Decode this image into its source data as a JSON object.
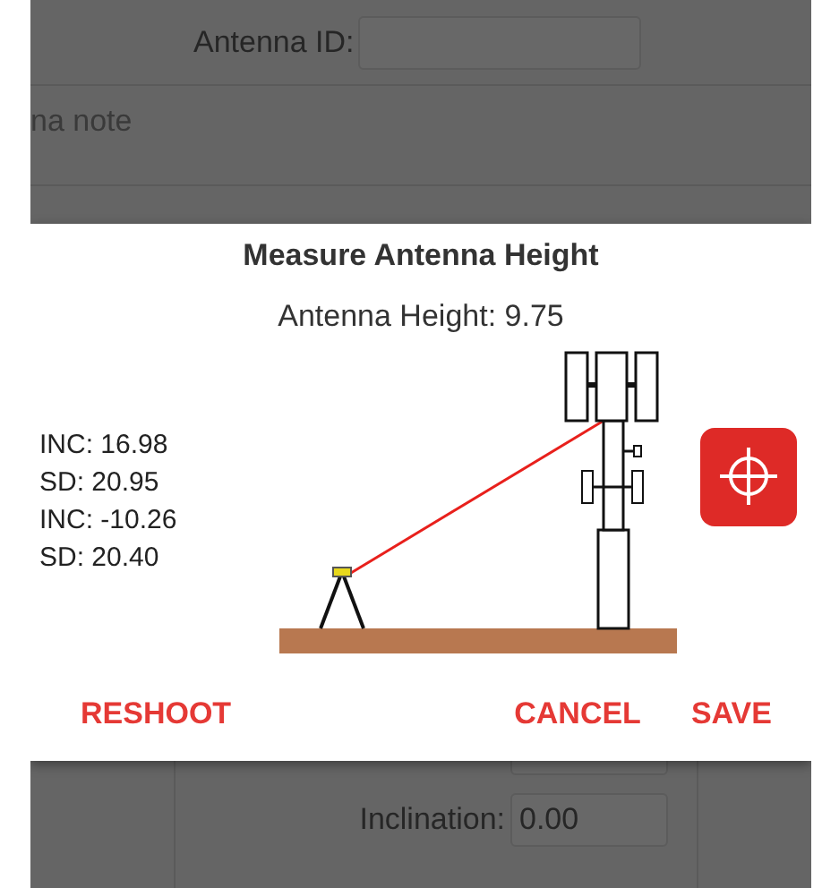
{
  "form": {
    "antenna_id": {
      "label": "Antenna ID:"
    },
    "note": {
      "placeholder": "na note"
    },
    "fields": [
      {
        "label": "Inclination:",
        "value": "0.00"
      }
    ]
  },
  "dialog": {
    "title": "Measure Antenna Height",
    "result": "Antenna Height: 9.75",
    "readings": [
      "INC: 16.98",
      "SD: 20.95",
      "INC: -10.26",
      "SD: 20.40"
    ],
    "actions": [
      {
        "label": "RESHOOT",
        "kind": "left"
      },
      {
        "label": "CANCEL",
        "kind": "right"
      },
      {
        "label": "SAVE",
        "kind": "right"
      }
    ]
  }
}
